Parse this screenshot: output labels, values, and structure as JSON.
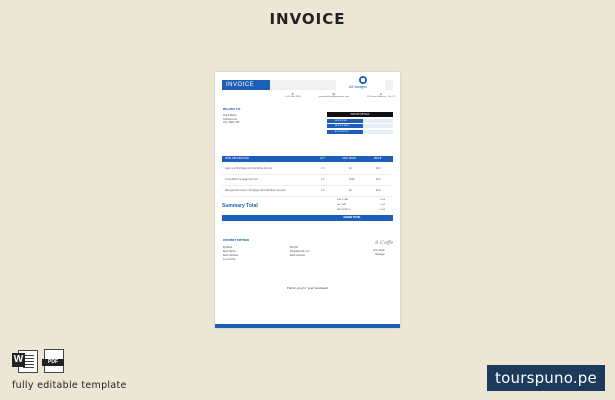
{
  "page_title": "INVOICE",
  "invoice": {
    "badge": "INVOICE",
    "company_name": "AZ Ideagen",
    "contacts": [
      {
        "icon": "phone-icon",
        "glyph": "✆",
        "text": "+123 456 7890"
      },
      {
        "icon": "email-icon",
        "glyph": "@",
        "text": "yourmail@companyname.com"
      },
      {
        "icon": "address-icon",
        "glyph": "⌂",
        "text": "123 Street Address, City, ST"
      }
    ],
    "billed_to_label": "BILLED TO",
    "billed_lines": [
      "Client Name",
      "Address Line",
      "City, State, ZIP"
    ],
    "details_header": "INVOICE DETAILS",
    "details_rows": [
      "INVOICE NO.",
      "INVOICE DATE",
      "ACCOUNT NO."
    ],
    "items_headers": [
      "ITEM DESCRIPTION",
      "QTY",
      "UNIT PRICE",
      "PRICE"
    ],
    "items": [
      {
        "desc": "Agency & Mortgage Administrative Service",
        "qty": "1.5",
        "unit": "$0",
        "price": "$0.0"
      },
      {
        "desc": "Consultation & Legal Services",
        "qty": "1.5",
        "unit": "$100",
        "price": "$0.0"
      },
      {
        "desc": "Management Lease / Mortgage Administrative Services",
        "qty": "1.5",
        "unit": "$0",
        "price": "$0.0"
      }
    ],
    "summary_label": "Summary Total",
    "totals": [
      {
        "label": "SUB TOTAL",
        "value": "0.00"
      },
      {
        "label": "Tax / VAT",
        "value": "0.00"
      },
      {
        "label": "DISCOUNT %",
        "value": "0.00"
      }
    ],
    "grand_total_label": "GRAND TOTAL",
    "payment_label": "PAYMENT METHOD",
    "payment_col1": [
      "By Bank",
      "Bank Name",
      "Bank Address",
      "Account No."
    ],
    "payment_col2": [
      "Pay Pal",
      "Paypal@mail.com",
      "Bank Address"
    ],
    "signature": "S Coffe",
    "sign_lines": [
      "John Smith",
      "Manager"
    ],
    "thanks": "Thank you for your business!"
  },
  "file_icons": {
    "word_letter": "W",
    "pdf_label": "PDF"
  },
  "editable_text": "fully editable template",
  "brand": "tourspuno.pe"
}
